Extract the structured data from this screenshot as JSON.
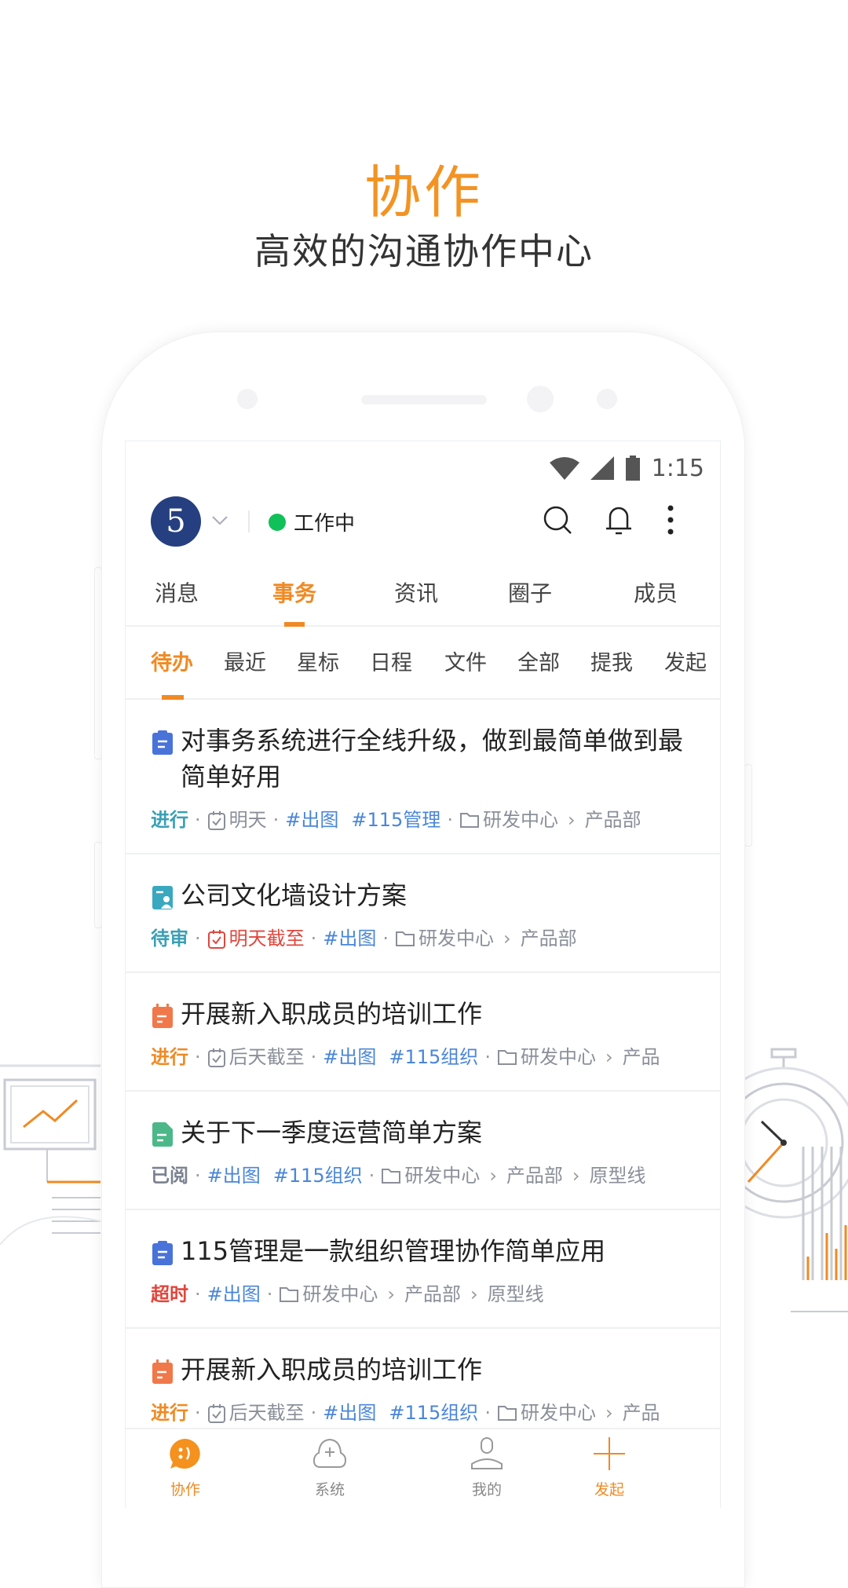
{
  "hero": {
    "title": "协作",
    "subtitle": "高效的沟通协作中心"
  },
  "status_bar": {
    "time": "1:15"
  },
  "header": {
    "avatar_text": "5",
    "status_text": "工作中",
    "status_color": "#10c058"
  },
  "tabs": [
    {
      "label": "消息"
    },
    {
      "label": "事务",
      "active": true
    },
    {
      "label": "资讯"
    },
    {
      "label": "圈子"
    },
    {
      "label": "成员"
    }
  ],
  "subtabs": [
    {
      "label": "待办",
      "active": true
    },
    {
      "label": "最近"
    },
    {
      "label": "星标"
    },
    {
      "label": "日程"
    },
    {
      "label": "文件"
    },
    {
      "label": "全部"
    },
    {
      "label": "提我"
    },
    {
      "label": "发起"
    }
  ],
  "colors": {
    "accent": "#f08a24",
    "tag": "#4a86d8",
    "muted": "#8a8f99"
  },
  "items": [
    {
      "icon": "clipboard-icon",
      "icon_color": "#4a73d9",
      "title": "对事务系统进行全线升级，做到最简单做到最简单好用",
      "status": "进行",
      "status_color": "#3a9fb5",
      "due": "明天",
      "due_color": "#8a8f99",
      "tags": [
        "#出图",
        "#115管理"
      ],
      "path": [
        "研发中心",
        "产品部"
      ]
    },
    {
      "icon": "review-doc-icon",
      "icon_color": "#3aa8bf",
      "title": "公司文化墙设计方案",
      "status": "待审",
      "status_color": "#3a9fb5",
      "due": "明天截至",
      "due_color": "#e0463c",
      "tags": [
        "#出图"
      ],
      "path": [
        "研发中心",
        "产品部"
      ]
    },
    {
      "icon": "calendar-icon",
      "icon_color": "#f0784a",
      "title": "开展新入职成员的培训工作",
      "status": "进行",
      "status_color": "#f08a24",
      "due": "后天截至",
      "due_color": "#8a8f99",
      "tags": [
        "#出图",
        "#115组织"
      ],
      "path": [
        "研发中心",
        "产品"
      ]
    },
    {
      "icon": "document-icon",
      "icon_color": "#4cb88a",
      "title": "关于下一季度运营简单方案",
      "status": "已阅",
      "status_color": "#7a8190",
      "due": null,
      "tags": [
        "#出图",
        "#115组织"
      ],
      "path": [
        "研发中心",
        "产品部",
        "原型线"
      ]
    },
    {
      "icon": "clipboard-icon",
      "icon_color": "#4a73d9",
      "title": "115管理是一款组织管理协作简单应用",
      "status": "超时",
      "status_color": "#e0463c",
      "due": null,
      "tags": [
        "#出图"
      ],
      "path": [
        "研发中心",
        "产品部",
        "原型线"
      ]
    },
    {
      "icon": "calendar-icon",
      "icon_color": "#f0784a",
      "title": "开展新入职成员的培训工作",
      "status": "进行",
      "status_color": "#f08a24",
      "due": "后天截至",
      "due_color": "#8a8f99",
      "tags": [
        "#出图",
        "#115组织"
      ],
      "path": [
        "研发中心",
        "产品"
      ]
    }
  ],
  "bottom_nav": [
    {
      "label": "协作",
      "icon": "chat-bubble-icon",
      "active": true
    },
    {
      "label": "系统",
      "icon": "cloud-plus-icon"
    },
    {
      "label": "我的",
      "icon": "user-icon"
    },
    {
      "label": "发起",
      "icon": "plus-icon",
      "active": true
    }
  ]
}
